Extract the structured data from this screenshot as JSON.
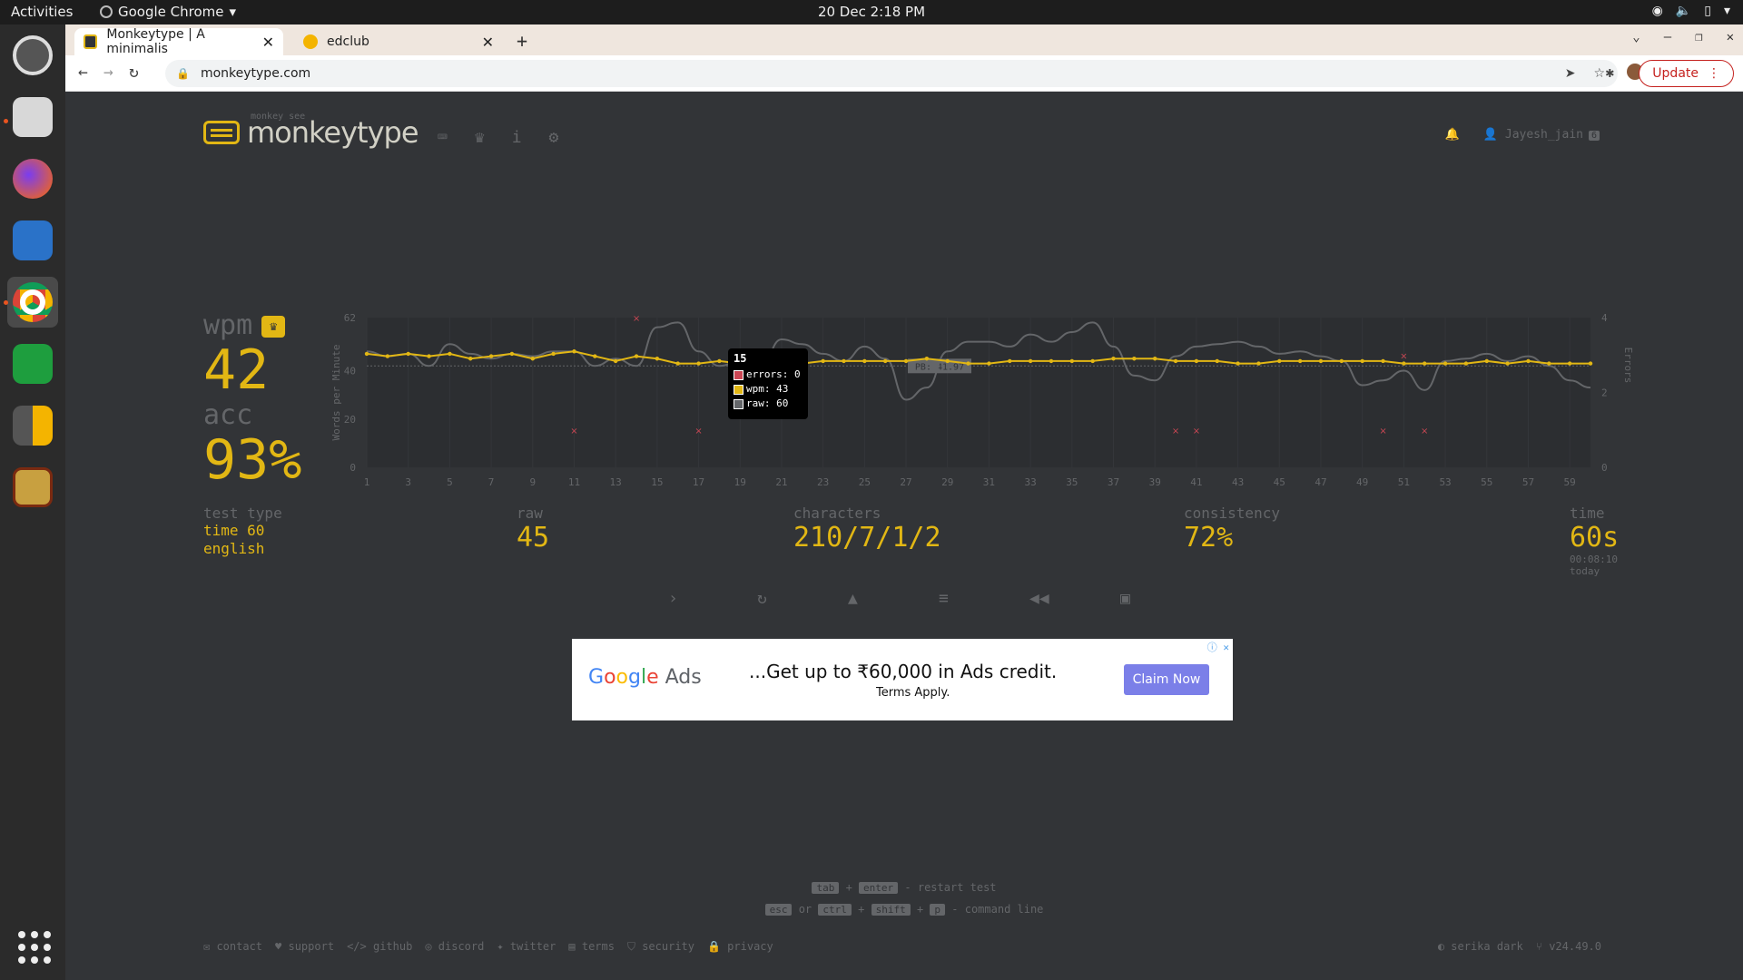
{
  "system": {
    "activities": "Activities",
    "app_name": "Google Chrome",
    "clock": "20 Dec  2:18 PM"
  },
  "browser": {
    "tabs": [
      {
        "title": "Monkeytype | A minimalis",
        "active": true
      },
      {
        "title": "edclub",
        "active": false
      }
    ],
    "url": "monkeytype.com",
    "update_label": "Update"
  },
  "site": {
    "logo_small": "monkey see",
    "logo_text": "monkeytype",
    "username": "Jayesh_jain",
    "level": "6"
  },
  "result": {
    "wpm_label": "wpm",
    "wpm": "42",
    "acc_label": "acc",
    "acc": "93%",
    "test_type_label": "test type",
    "test_type_lines": [
      "time 60",
      "english"
    ],
    "raw_label": "raw",
    "raw": "45",
    "characters_label": "characters",
    "characters": "210/7/1/2",
    "consistency_label": "consistency",
    "consistency": "72%",
    "time_label": "time",
    "time": "60s",
    "time_sub": "00:08:10 today"
  },
  "tooltip": {
    "title": "15",
    "errors": "errors: 0",
    "wpm": "wpm: 43",
    "raw": "raw: 60"
  },
  "chart_data": {
    "type": "line",
    "ylabel": "Words per Minute",
    "y2label": "Errors",
    "ylim": [
      0,
      62
    ],
    "y2lim": [
      0,
      4
    ],
    "y_ticks": [
      "0",
      "20",
      "40",
      "62"
    ],
    "y2_ticks": [
      "0",
      "2",
      "4"
    ],
    "x_ticks": [
      "1",
      "3",
      "5",
      "7",
      "9",
      "11",
      "13",
      "15",
      "17",
      "19",
      "21",
      "23",
      "25",
      "27",
      "29",
      "31",
      "33",
      "35",
      "37",
      "39",
      "41",
      "43",
      "45",
      "47",
      "49",
      "51",
      "53",
      "55",
      "57",
      "59"
    ],
    "pb_label": "PB: 41.97",
    "pb_value": 41.97,
    "series": [
      {
        "name": "wpm",
        "color": "#e2b714",
        "values": [
          47,
          46,
          47,
          46,
          47,
          45,
          46,
          47,
          45,
          47,
          48,
          46,
          44,
          46,
          45,
          43,
          43,
          44,
          43,
          43,
          43,
          43,
          44,
          44,
          44,
          44,
          44,
          45,
          44,
          43,
          43,
          44,
          44,
          44,
          44,
          44,
          45,
          45,
          45,
          44,
          44,
          44,
          43,
          43,
          44,
          44,
          44,
          44,
          44,
          44,
          43,
          43,
          43,
          43,
          44,
          43,
          44,
          43,
          43,
          43
        ]
      },
      {
        "name": "raw",
        "color": "#646669",
        "values": [
          48,
          46,
          47,
          42,
          51,
          47,
          45,
          47,
          46,
          48,
          48,
          42,
          45,
          42,
          58,
          60,
          48,
          42,
          44,
          42,
          53,
          51,
          47,
          44,
          50,
          45,
          28,
          33,
          48,
          52,
          52,
          50,
          55,
          52,
          56,
          60,
          50,
          38,
          36,
          46,
          50,
          51,
          52,
          50,
          47,
          48,
          46,
          44,
          34,
          36,
          40,
          32,
          44,
          45,
          47,
          44,
          46,
          42,
          36,
          33
        ]
      },
      {
        "name": "errors",
        "color": "#ca4754",
        "points": [
          [
            11,
            1
          ],
          [
            14,
            4
          ],
          [
            17,
            1
          ],
          [
            40,
            1
          ],
          [
            41,
            1
          ],
          [
            50,
            1
          ],
          [
            51,
            3
          ],
          [
            52,
            1
          ]
        ]
      }
    ]
  },
  "footer": {
    "hint1": [
      "tab",
      "+",
      "enter",
      "- restart test"
    ],
    "hint2": [
      "esc",
      "or",
      "ctrl",
      "+",
      "shift",
      "+",
      "p",
      "- command line"
    ],
    "links": [
      "contact",
      "support",
      "github",
      "discord",
      "twitter",
      "terms",
      "security",
      "privacy"
    ],
    "theme": "serika dark",
    "version": "v24.49.0"
  },
  "ad": {
    "brand": "Google Ads",
    "headline": "...Get up to ₹60,000 in Ads credit.",
    "terms": "Terms Apply.",
    "cta": "Claim Now"
  },
  "colors": {
    "accent": "#e2b714",
    "bg": "#323437",
    "sub": "#646669",
    "error": "#ca4754"
  }
}
